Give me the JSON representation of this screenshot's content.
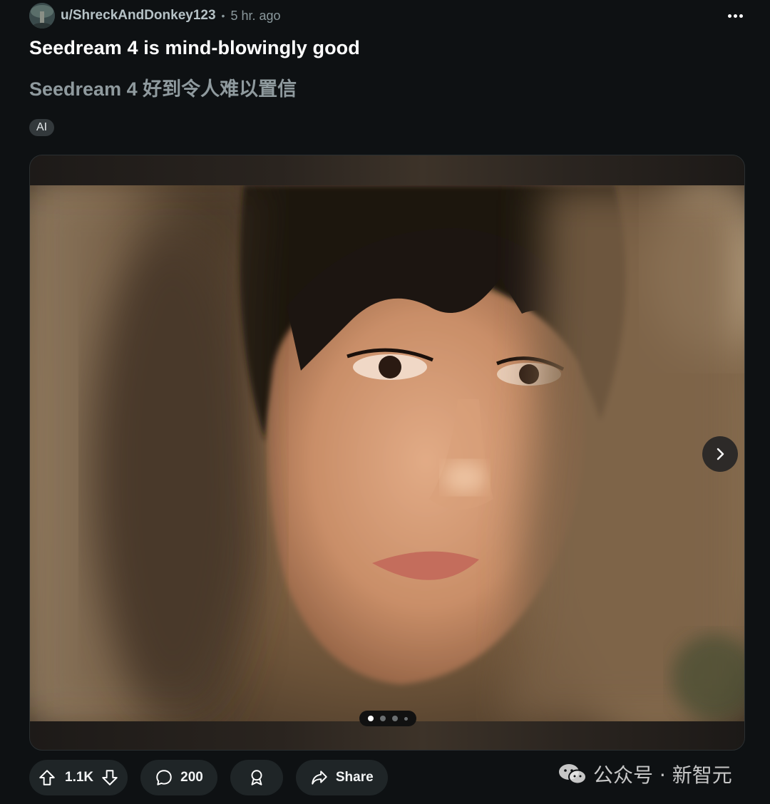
{
  "post": {
    "author": "u/ShreckAndDonkey123",
    "separator": "•",
    "time_ago": "5 hr. ago",
    "title": "Seedream 4 is mind-blowingly good",
    "subtitle": "Seedream 4 好到令人难以置信",
    "flair": "AI"
  },
  "gallery": {
    "current_index": 1,
    "total_images": 4,
    "image_description_icon": "portrait-photo"
  },
  "actions": {
    "upvote_count": "1.1K",
    "comment_count": "200",
    "share_label": "Share"
  },
  "watermark": {
    "text": "公众号 · 新智元"
  }
}
